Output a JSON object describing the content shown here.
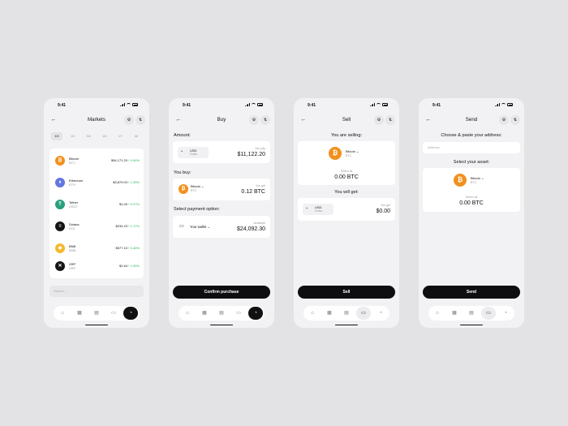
{
  "status_time": "9:41",
  "markets": {
    "title": "Markets",
    "tabs": [
      "1H",
      "1D",
      "1W",
      "1M",
      "1Y",
      "All"
    ],
    "rows": [
      {
        "name": "Bitcoin",
        "symbol": "BTC",
        "price": "$94,171.20",
        "change": "+ 0.64%",
        "color": "#f2901e",
        "icon": "₿"
      },
      {
        "name": "Ethereum",
        "symbol": "ETH",
        "price": "$3,879.03",
        "change": "+ 1.05%",
        "color": "#6476e0",
        "icon": "♦"
      },
      {
        "name": "Tether",
        "symbol": "USDT",
        "price": "$1.00",
        "change": "+ 0.07%",
        "color": "#26a17b",
        "icon": "T"
      },
      {
        "name": "Solana",
        "symbol": "SOL",
        "price": "$234.23",
        "change": "+ 1.17%",
        "color": "#151515",
        "icon": "≡"
      },
      {
        "name": "BNB",
        "symbol": "BNB",
        "price": "$577.10",
        "change": "+ 0.46%",
        "color": "#f3ba2f",
        "icon": "◆"
      },
      {
        "name": "XRP",
        "symbol": "XRP",
        "price": "$1.64",
        "change": "+ 1.95%",
        "color": "#151515",
        "icon": "✕"
      }
    ],
    "search_placeholder": "Search..."
  },
  "buy": {
    "title": "Buy",
    "amount_label": "Amount:",
    "currency": "USD",
    "currency_sub": "Dollar",
    "pay_label": "You pay",
    "pay_value": "$11,122.20",
    "you_buy_label": "You buy:",
    "coin": "Bitcoin",
    "coin_sym": "BTC",
    "get_label": "You get",
    "get_value": "0.12 BTC",
    "payment_label": "Select payment option:",
    "wallet": "Your wallet",
    "available_label": "Available",
    "available_value": "$24,092.30",
    "cta": "Confirm purchase"
  },
  "sell": {
    "title": "Sell",
    "selling_label": "You are selling:",
    "coin": "Bitcoin",
    "coin_sym": "BTC",
    "select_all": "Select all",
    "amount": "0.00 BTC",
    "will_get_label": "You will get:",
    "currency": "USD",
    "currency_sub": "Dollar",
    "get_label": "You get",
    "get_value": "$0.00",
    "cta": "Sell"
  },
  "send": {
    "title": "Send",
    "address_label": "Choose & paste your address:",
    "address_placeholder": "Address",
    "asset_label": "Select your asset:",
    "coin": "Bitcoin",
    "coin_sym": "BTC",
    "select_all": "Select all",
    "amount": "0.00 BTC",
    "cta": "Send"
  },
  "colors": {
    "bitcoin": "#f2901e",
    "positive": "#2db45a",
    "cta": "#0e0e10"
  },
  "nav_icons": [
    "home-icon",
    "grid-icon",
    "document-icon",
    "wallet-icon",
    "pie-chart-icon"
  ]
}
